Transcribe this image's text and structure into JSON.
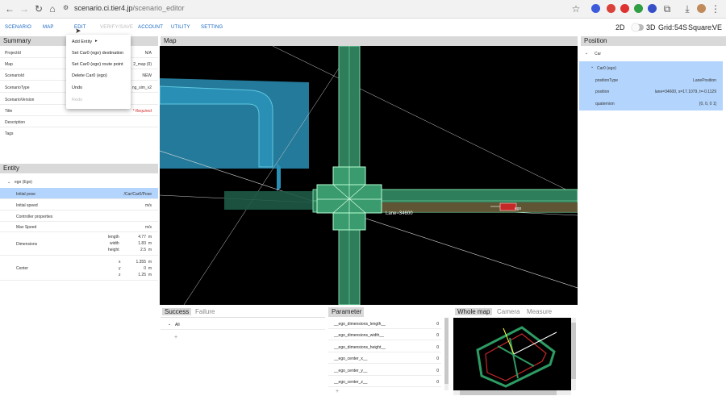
{
  "browser": {
    "url_host": "scenario.ci.tier4.jp",
    "url_path": "/scenario_editor"
  },
  "nav": {
    "items": [
      "SCENARIO",
      "MAP",
      "EDIT",
      "VERIFY/SAVE",
      "ACCOUNT",
      "UTILITY",
      "SETTING"
    ],
    "view_2d": "2D",
    "view_3d": "3D",
    "grid_label": "Grid:",
    "grid_value": "54S",
    "square_label": "Square:",
    "square_value": "VE"
  },
  "edit_menu": {
    "items": [
      "Add Entity",
      "Set Car0 (ego) destination",
      "Set Car0 (ego) route point",
      "Delete Car0 (ego)",
      "Undo",
      "Redo"
    ]
  },
  "summary": {
    "title": "Summary",
    "rows": [
      {
        "k": "ProjectId",
        "v": "N/A"
      },
      {
        "k": "Map",
        "v": "2_map (0)"
      },
      {
        "k": "ScenarioId",
        "v": "NEW"
      },
      {
        "k": "ScenarioType",
        "v": "ng_sim_v2"
      },
      {
        "k": "ScenarioVersion",
        "v": ""
      },
      {
        "k": "Title",
        "v": "* Required"
      },
      {
        "k": "Description",
        "v": ""
      },
      {
        "k": "Tags",
        "v": ""
      }
    ]
  },
  "entity": {
    "title": "Entity",
    "tree_root": "ego (Ego)",
    "initial_pose_label": "Initial pose",
    "initial_pose_value": "/Car/Car0/Pose",
    "initial_speed_label": "Initial speed",
    "initial_speed_unit": "m/s",
    "controller_label": "Controller properties",
    "max_speed_label": "Max Speed",
    "max_speed_unit": "m/s",
    "dimensions_label": "Dimensions",
    "dimensions": [
      {
        "k": "length",
        "v": "4.77",
        "u": "m"
      },
      {
        "k": "width",
        "v": "1.83",
        "u": "m"
      },
      {
        "k": "height",
        "v": "2.5",
        "u": "m"
      }
    ],
    "center_label": "Center",
    "center": [
      {
        "k": "x",
        "v": "1.355",
        "u": "m"
      },
      {
        "k": "y",
        "v": "0",
        "u": "m"
      },
      {
        "k": "z",
        "v": "1.25",
        "u": "m"
      }
    ]
  },
  "map_panel": {
    "title": "Map",
    "lane_label": "Lane=34600",
    "ego_label": "ego"
  },
  "position": {
    "title": "Position",
    "root": "Car",
    "child": "Car0 (ego)",
    "rows": [
      {
        "k": "positionType",
        "v": "LanePosition"
      },
      {
        "k": "position",
        "v": "lane=34600, s=17.1079, t=-0.1129"
      },
      {
        "k": "quaternion",
        "v": "[0, 0, 0 1]"
      }
    ]
  },
  "conditions": {
    "tab_success": "Success",
    "tab_failure": "Failure",
    "all_label": "All",
    "add_symbol": "+"
  },
  "parameter": {
    "title": "Parameter",
    "rows": [
      {
        "k": "__ego_dimensions_length__",
        "v": "0"
      },
      {
        "k": "__ego_dimensions_width__",
        "v": "0"
      },
      {
        "k": "__ego_dimensions_height__",
        "v": "0"
      },
      {
        "k": "__ego_center_x__",
        "v": "0"
      },
      {
        "k": "__ego_center_y__",
        "v": "0"
      },
      {
        "k": "__ego_center_z__",
        "v": "0"
      }
    ],
    "add_symbol": "+"
  },
  "minimap": {
    "tabs": [
      "Whole map",
      "Camera",
      "Measure"
    ]
  },
  "colors": {
    "accent": "#1565c0",
    "selected_row": "#b3d4fc",
    "map_bg": "#000000",
    "road_green": "#2e7d5b",
    "building_blue": "#2a8fb5",
    "ego_red": "#c62828"
  }
}
